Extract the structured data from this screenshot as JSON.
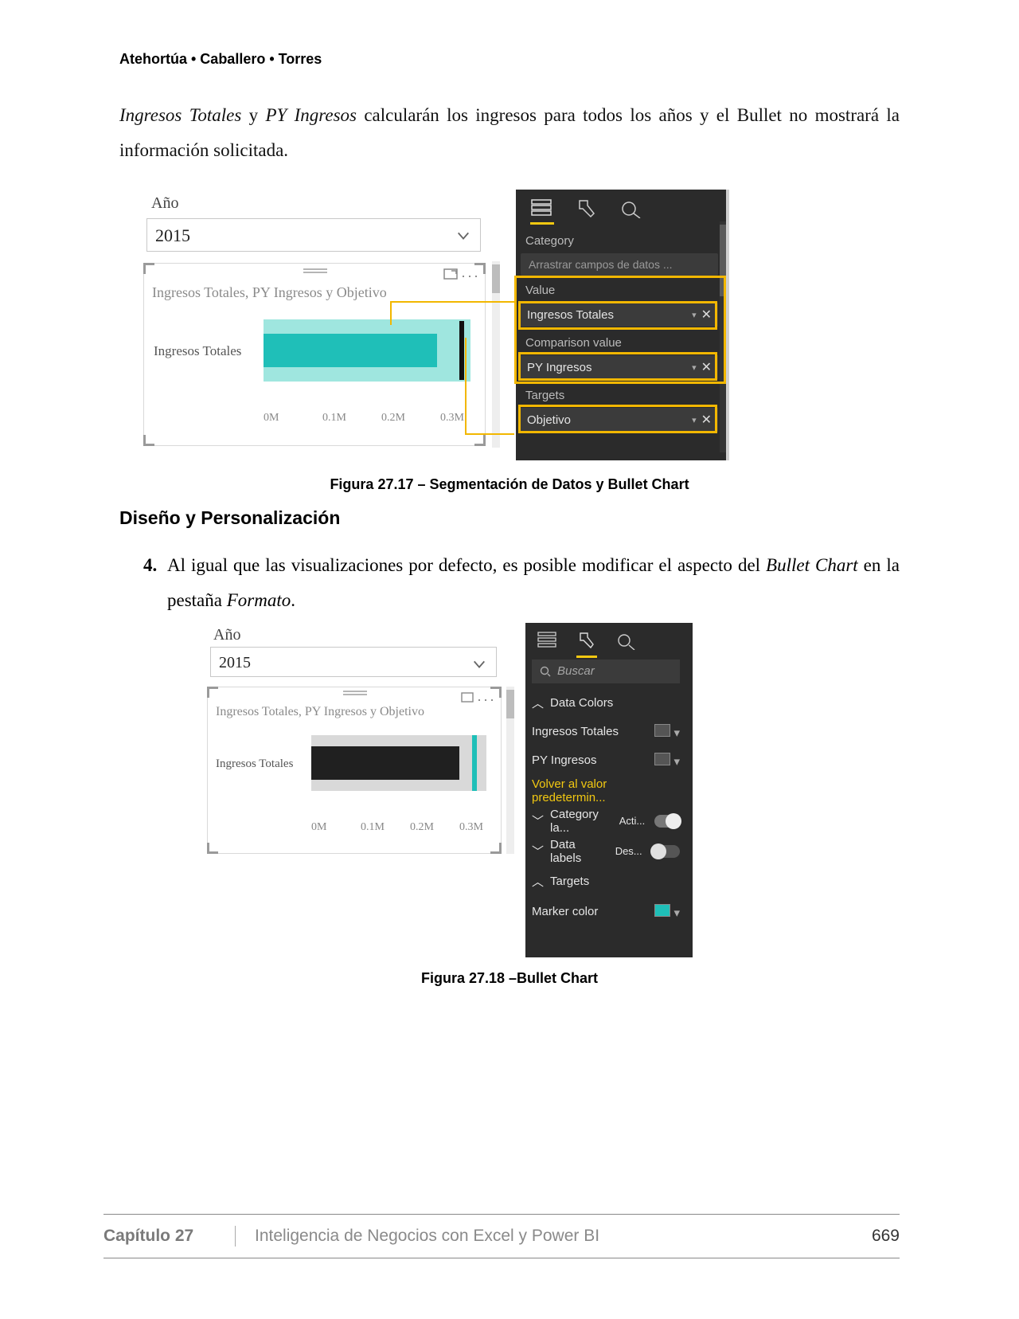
{
  "page": {
    "authors": "Atehortúa • Caballero • Torres",
    "intro_prefix_it1": "Ingresos Totales",
    "intro_mid": " y ",
    "intro_it2": "PY Ingresos",
    "intro_rest": " calcularán los ingresos para todos los años y el Bullet no mostrará la información solicitada.",
    "caption17": "Figura 27.17 – Segmentación de Datos y Bullet Chart",
    "heading": "Diseño y Personalización",
    "step_num": "4.",
    "step_text_a": "Al igual que las visualizaciones por defecto, es posible modificar el aspecto del ",
    "step_text_it1": "Bullet Chart",
    "step_text_b": " en la pestaña ",
    "step_text_it2": "Formato",
    "step_text_c": ".",
    "caption18": "Figura 27.18 –Bullet Chart",
    "footer_chapter": "Capítulo 27",
    "footer_title": "Inteligencia de Negocios con Excel y Power BI",
    "footer_page": "669"
  },
  "fig17": {
    "slicer_label": "Año",
    "slicer_value": "2015",
    "chart_title": "Ingresos Totales, PY Ingresos y Objetivo",
    "y_category": "Ingresos Totales",
    "x_ticks": [
      "0M",
      "0.1M",
      "0.2M",
      "0.3M"
    ],
    "panel": {
      "section_category": "Category",
      "category_placeholder": "Arrastrar campos de datos ...",
      "section_value": "Value",
      "value_field": "Ingresos Totales",
      "section_compare": "Comparison value",
      "compare_field": "PY Ingresos",
      "section_targets": "Targets",
      "targets_field": "Objetivo"
    }
  },
  "fig18": {
    "slicer_label": "Año",
    "slicer_value": "2015",
    "chart_title": "Ingresos Totales, PY Ingresos y Objetivo",
    "y_category": "Ingresos Totales",
    "x_ticks": [
      "0M",
      "0.1M",
      "0.2M",
      "0.3M"
    ],
    "panel": {
      "search_placeholder": "Buscar",
      "data_colors": "Data Colors",
      "row1": "Ingresos Totales",
      "row2": "PY Ingresos",
      "reset": "Volver al valor predetermin...",
      "category_labels": "Category la...",
      "category_state": "Acti...",
      "data_labels": "Data labels",
      "data_labels_state": "Des...",
      "targets": "Targets",
      "marker_color": "Marker color"
    }
  },
  "chart_data": [
    {
      "type": "bar",
      "title": "Ingresos Totales, PY Ingresos y Objetivo",
      "categories": [
        "Ingresos Totales"
      ],
      "series": [
        {
          "name": "PY Ingresos (banda clara)",
          "values": [
            0.34
          ]
        },
        {
          "name": "Ingresos Totales (barra)",
          "values": [
            0.28
          ]
        },
        {
          "name": "Objetivo (marcador)",
          "values": [
            0.33
          ]
        }
      ],
      "xlabel": "",
      "ylabel": "",
      "x_ticks": [
        "0M",
        "0.1M",
        "0.2M",
        "0.3M"
      ],
      "xlim": [
        0,
        0.34
      ]
    },
    {
      "type": "bar",
      "title": "Ingresos Totales, PY Ingresos y Objetivo",
      "categories": [
        "Ingresos Totales"
      ],
      "series": [
        {
          "name": "PY Ingresos (banda gris)",
          "values": [
            0.34
          ]
        },
        {
          "name": "Ingresos Totales (barra)",
          "values": [
            0.28
          ]
        },
        {
          "name": "Objetivo (marcador)",
          "values": [
            0.33
          ]
        }
      ],
      "xlabel": "",
      "ylabel": "",
      "x_ticks": [
        "0M",
        "0.1M",
        "0.2M",
        "0.3M"
      ],
      "xlim": [
        0,
        0.34
      ]
    }
  ]
}
